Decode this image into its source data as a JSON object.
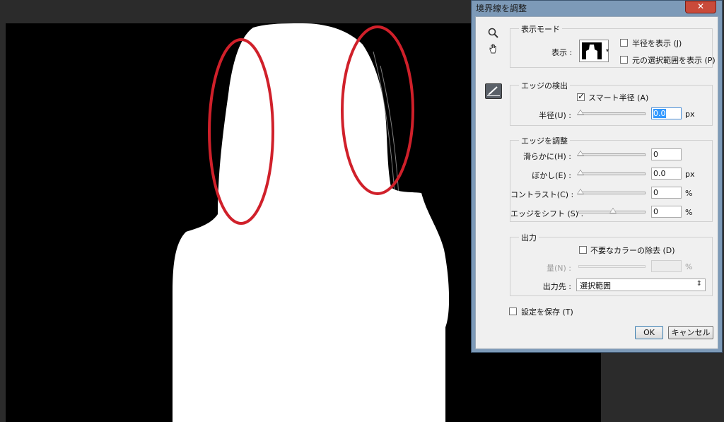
{
  "dialog": {
    "title": "境界線を調整",
    "close_label": "✕"
  },
  "tools": {
    "zoom": "zoom-tool",
    "hand": "hand-tool",
    "refine_brush": "refine-radius-brush"
  },
  "view_mode": {
    "group_title": "表示モード",
    "view_label": "表示 :",
    "show_radius": {
      "label": "半径を表示 (J)",
      "checked": false
    },
    "show_original": {
      "label": "元の選択範囲を表示 (P)",
      "checked": false
    }
  },
  "edge_detection": {
    "group_title": "エッジの検出",
    "smart_radius": {
      "label": "スマート半径 (A)",
      "checked": true
    },
    "radius_label": "半径(U) :",
    "radius_value": "0.0",
    "radius_unit": "px"
  },
  "adjust_edge": {
    "group_title": "エッジを調整",
    "rows": [
      {
        "label": "滑らかに(H) :",
        "value": "0",
        "unit": ""
      },
      {
        "label": "ぼかし(E) :",
        "value": "0.0",
        "unit": "px"
      },
      {
        "label": "コントラスト(C) :",
        "value": "0",
        "unit": "%"
      },
      {
        "label": "エッジをシフト (S) :",
        "value": "0",
        "unit": "%"
      }
    ]
  },
  "output": {
    "group_title": "出力",
    "decontaminate": {
      "label": "不要なカラーの除去 (D)",
      "checked": false
    },
    "amount_label": "量(N) :",
    "amount_value": "",
    "amount_unit": "%",
    "output_to_label": "出力先 :",
    "output_to_value": "選択範囲"
  },
  "remember": {
    "label": "設定を保存 (T)",
    "checked": false
  },
  "buttons": {
    "ok": "OK",
    "cancel": "キャンセル"
  },
  "colors": {
    "annotation_red": "#d0202a",
    "dialog_frame": "#7d9ab8",
    "mask_fg": "#ffffff",
    "mask_bg": "#000000"
  }
}
